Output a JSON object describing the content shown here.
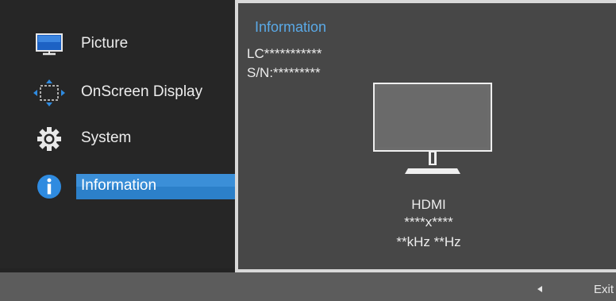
{
  "menu": {
    "items": [
      {
        "label": "Picture",
        "icon": "monitor-icon"
      },
      {
        "label": "OnScreen Display",
        "icon": "osd-move-icon"
      },
      {
        "label": "System",
        "icon": "gear-icon"
      },
      {
        "label": "Information",
        "icon": "info-icon"
      }
    ],
    "selected_label": "Information"
  },
  "panel": {
    "title": "Information",
    "model": "LC***********",
    "serial": "S/N:*********",
    "icon": "monitor-icon",
    "source": "HDMI",
    "resolution": "****x****",
    "frequency": "**kHz **Hz"
  },
  "footer": {
    "back_icon": "triangle-left-icon",
    "exit_label": "Exit"
  },
  "colors": {
    "accent_title": "#5aa9e6",
    "selection": "#2c80c9",
    "panel_bg": "#474747",
    "menu_bg": "#262626"
  }
}
